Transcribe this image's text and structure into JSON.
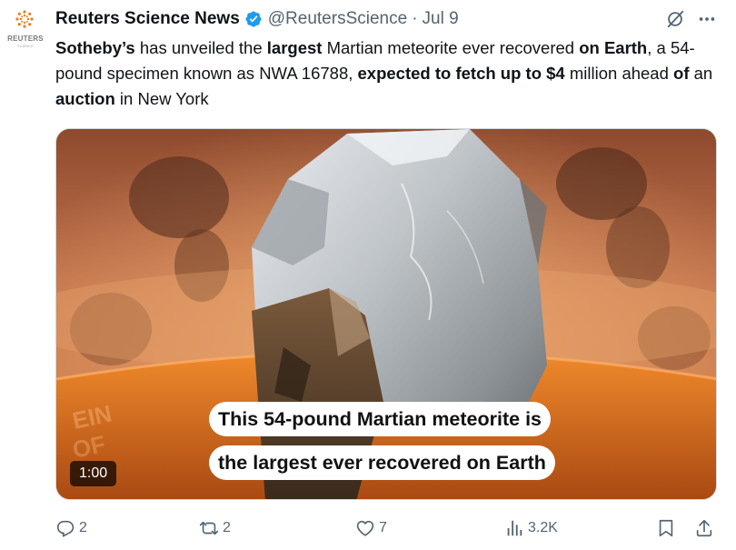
{
  "post": {
    "author_name": "Reuters Science News",
    "handle": "@ReutersScience",
    "separator": "·",
    "date": "Jul 9",
    "avatar_wordmark": "REUTERS",
    "avatar_subtext": "SCIENCE",
    "text_segments": [
      {
        "text": "Sotheby’s",
        "bold": true
      },
      {
        "text": " has unveiled the ",
        "bold": false
      },
      {
        "text": "largest",
        "bold": true
      },
      {
        "text": " Martian meteorite ever recovered ",
        "bold": false
      },
      {
        "text": "on Earth",
        "bold": true
      },
      {
        "text": ", a 54-pound specimen known as NWA 16788, ",
        "bold": false
      },
      {
        "text": "expected to fetch up to $4",
        "bold": true
      },
      {
        "text": " million ahead ",
        "bold": false
      },
      {
        "text": "of",
        "bold": true
      },
      {
        "text": " an ",
        "bold": false
      },
      {
        "text": "auction",
        "bold": true
      },
      {
        "text": " in New York",
        "bold": false
      }
    ]
  },
  "media": {
    "caption_line1": "This 54-pound Martian meteorite is",
    "caption_line2": "the largest ever recovered on Earth",
    "duration": "1:00"
  },
  "actions": {
    "replies": "2",
    "reposts": "2",
    "likes": "7",
    "views": "3.2K"
  },
  "icons": [
    "verified-badge-icon",
    "grok-icon",
    "more-icon",
    "reply-icon",
    "repost-icon",
    "like-icon",
    "views-icon",
    "bookmark-icon",
    "share-icon"
  ],
  "colors": {
    "verified": "#1d9bf0",
    "secondary_text": "#536471",
    "reuters_orange": "#f07d19"
  }
}
